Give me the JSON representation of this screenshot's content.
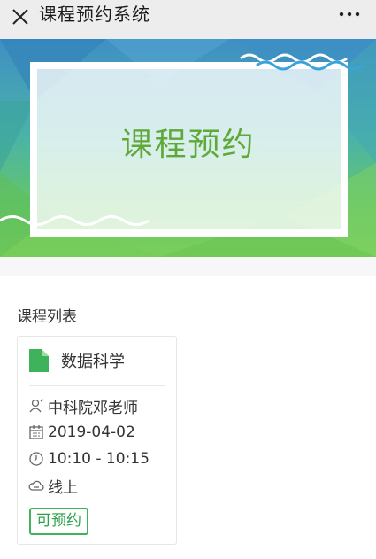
{
  "app": {
    "title": "课程预约系统"
  },
  "banner": {
    "title": "课程预约"
  },
  "section": {
    "title": "课程列表"
  },
  "courses": [
    {
      "name": "数据科学",
      "teacher": "中科院邓老师",
      "date": "2019-04-02",
      "time": "10:10 - 10:15",
      "location": "线上",
      "status": "可预约"
    }
  ],
  "icons": {
    "close": "close-icon",
    "more": "more-icon",
    "course": "document-icon",
    "teacher": "user-icon",
    "date": "calendar-icon",
    "time": "clock-icon",
    "location": "cloud-icon"
  },
  "colors": {
    "accent": "#5fa83a",
    "status": "#2aa34a",
    "titlebar_bg": "#ededed"
  }
}
